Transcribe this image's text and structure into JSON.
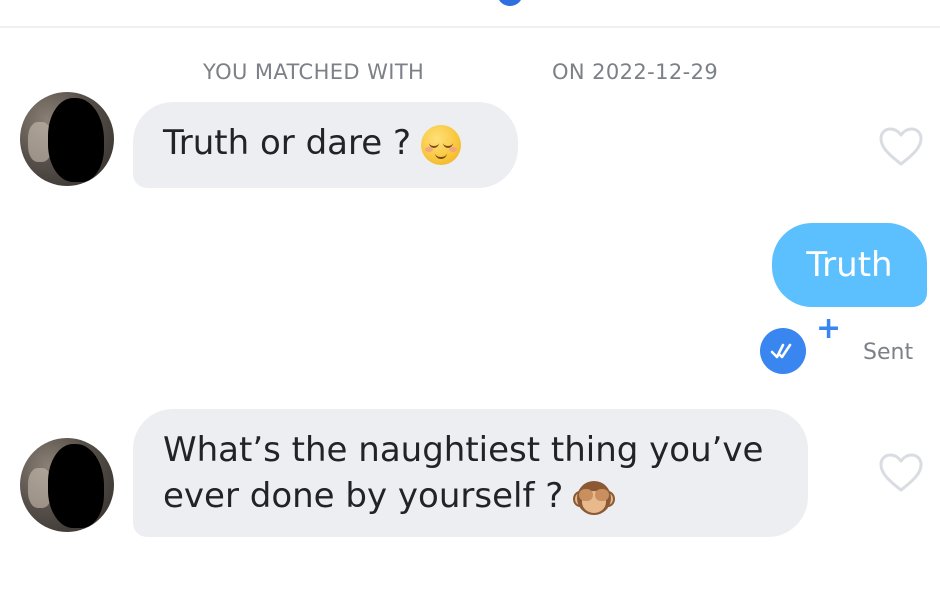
{
  "header": {
    "matched_with": "YOU MATCHED WITH",
    "matched_on": "ON 2022-12-29"
  },
  "messages": [
    {
      "direction": "incoming",
      "text": "Truth or dare ?",
      "emoji": "relieved-face-emoji"
    },
    {
      "direction": "outgoing",
      "text": "Truth",
      "status": "Sent"
    },
    {
      "direction": "incoming",
      "line1": "What’s the naughtiest thing you’ve",
      "line2": "ever done by yourself ?",
      "emoji": "see-no-evil-monkey-emoji"
    }
  ],
  "colors": {
    "incoming_bubble": "#eceef1",
    "outgoing_bubble": "#5cc0ff",
    "read_badge": "#3a86f0",
    "meta_text": "#7c8087"
  },
  "icons": {
    "like": "heart-outline-icon",
    "read": "double-check-icon",
    "add": "plus-icon"
  }
}
